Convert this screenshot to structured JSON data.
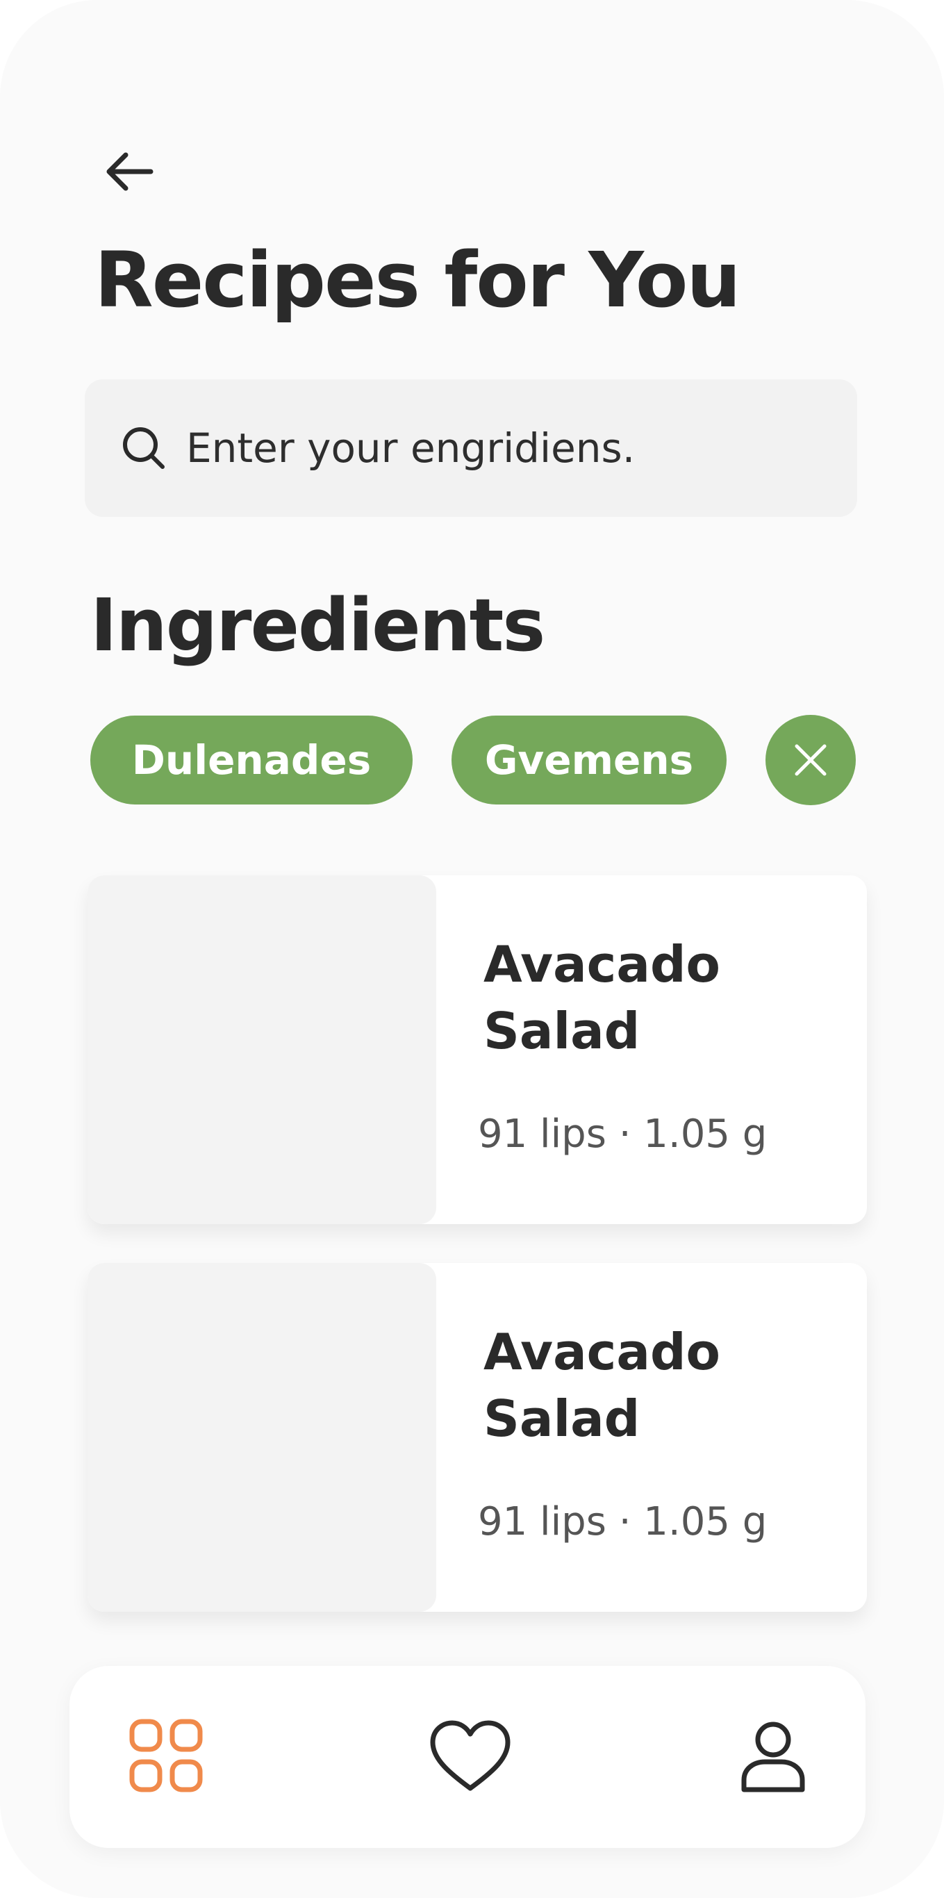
{
  "header": {
    "title": "Recipes for You",
    "back_icon": "arrow-left-icon"
  },
  "search": {
    "placeholder": "Enter your engridiens.",
    "value": "",
    "icon": "search-icon"
  },
  "ingredients": {
    "title": "Ingredients",
    "chips": [
      {
        "label": "Dulenades"
      },
      {
        "label": "Gvemens"
      }
    ],
    "clear_icon": "close-icon"
  },
  "recipes": [
    {
      "title": "Avacado Salad",
      "meta": "91 lips · 1.05 g"
    },
    {
      "title": "Avacado Salad",
      "meta": "91 lips · 1.05 g"
    }
  ],
  "bottom_nav": {
    "items": [
      {
        "icon": "grid-icon",
        "active": true
      },
      {
        "icon": "heart-icon",
        "active": false
      },
      {
        "icon": "user-icon",
        "active": false
      }
    ]
  },
  "colors": {
    "accent": "#75a85a",
    "active_nav": "#f08a4b",
    "background": "#fafafa",
    "text": "#2a2a2a"
  }
}
